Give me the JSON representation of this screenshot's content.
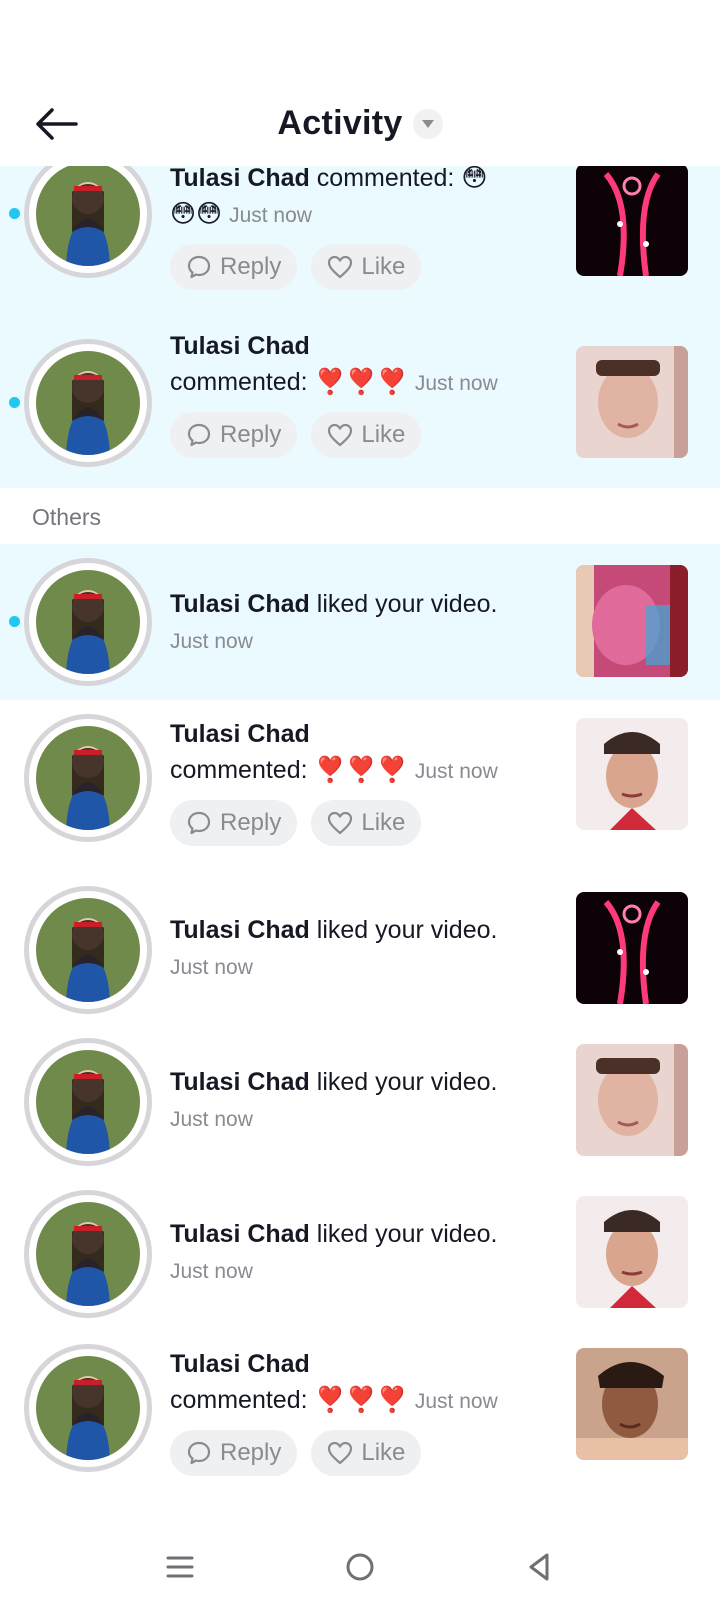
{
  "header": {
    "title": "Activity",
    "back_icon": "arrow-left-icon",
    "dropdown_icon": "caret-down-icon"
  },
  "unread_color": "#eafaff",
  "dot_color": "#20c7ee",
  "actions": {
    "reply": "Reply",
    "like": "Like"
  },
  "sections": {
    "others": "Others"
  },
  "rows": [
    {
      "name": "Tulasi Chad",
      "verb": "commented:",
      "emoji": "😳",
      "emoji2": "😳😳",
      "time": "Just now"
    },
    {
      "name": "Tulasi Chad",
      "verb": "commented:",
      "emoji": "❣️❣️❣️",
      "time": "Just now"
    },
    {
      "name": "Tulasi Chad",
      "verb": "liked your video.",
      "time": "Just now"
    },
    {
      "name": "Tulasi Chad",
      "verb": "commented:",
      "emoji": "❣️❣️❣️",
      "time": "Just now"
    },
    {
      "name": "Tulasi Chad",
      "verb": "liked your video.",
      "time": "Just now"
    },
    {
      "name": "Tulasi Chad",
      "verb": "liked your video.",
      "time": "Just now"
    },
    {
      "name": "Tulasi Chad",
      "verb": "liked your video.",
      "time": "Just now"
    },
    {
      "name": "Tulasi Chad",
      "verb": "commented:",
      "emoji": "❣️❣️❣️",
      "time": "Just now"
    }
  ],
  "navbar": {
    "menu_icon": "menu-icon",
    "home_icon": "home-circle-icon",
    "back_icon": "back-triangle-icon"
  }
}
